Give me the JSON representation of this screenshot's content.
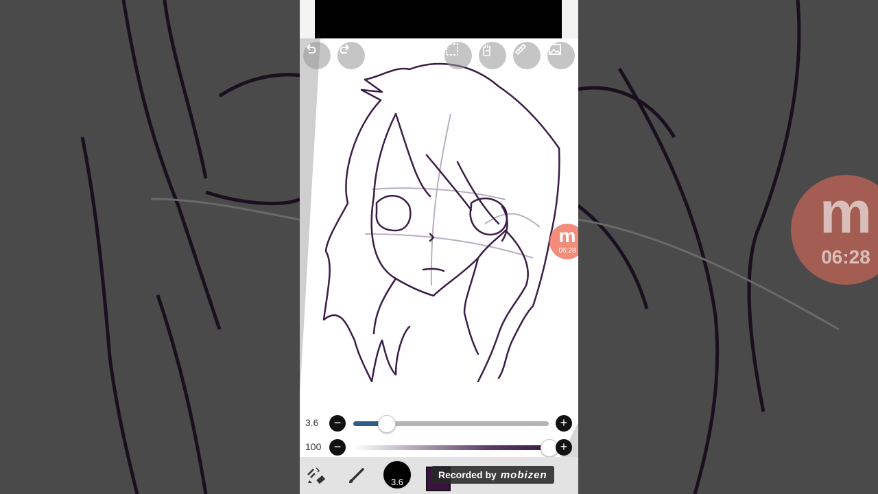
{
  "toolbar": {
    "undo_icon": "undo-icon",
    "redo_icon": "redo-icon",
    "selection_icon": "selection-icon",
    "hand_icon": "hand-icon",
    "ruler_icon": "ruler-icon",
    "image_icon": "image-icon"
  },
  "brush_size": {
    "value": "3.6",
    "minus_label": "−",
    "plus_label": "+",
    "fraction": 0.17
  },
  "opacity": {
    "value": "100",
    "minus_label": "−",
    "plus_label": "+",
    "fraction": 1.0
  },
  "bottom_bar": {
    "brush_size_label": "3.6",
    "color": "#3b123d"
  },
  "recorder": {
    "label": "Recorded by",
    "brand": "mobizen",
    "timer": "06:28",
    "logo_letter": "m"
  },
  "colors": {
    "accent": "#2f5d86",
    "stroke": "#3a1d47"
  }
}
